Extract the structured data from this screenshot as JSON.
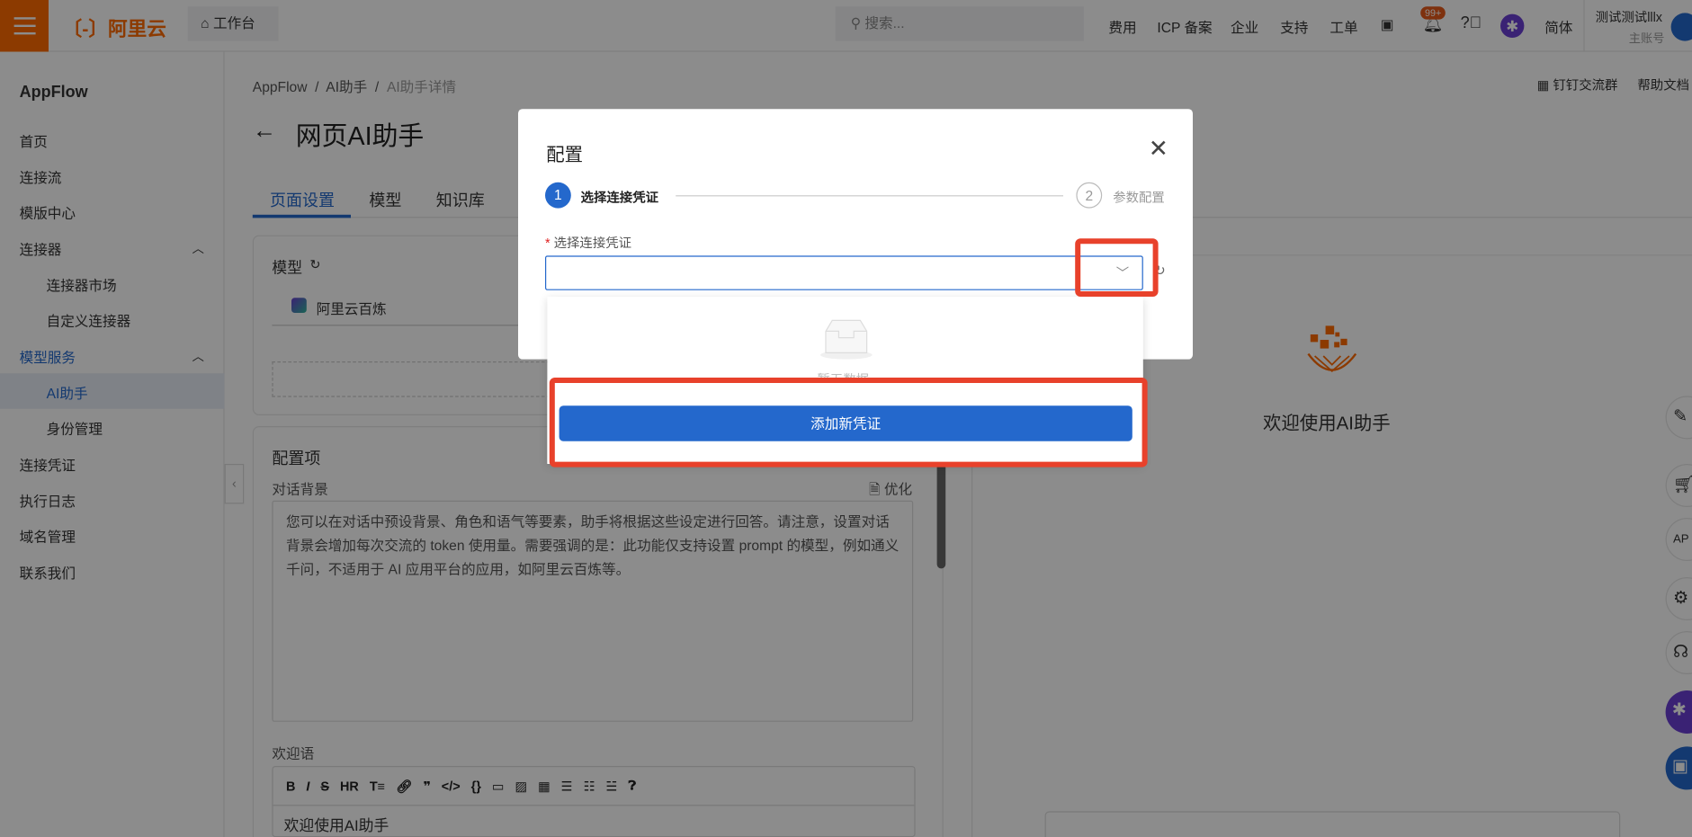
{
  "header": {
    "logo": "阿里云",
    "workbench": "工作台",
    "search_placeholder": "搜索...",
    "nav": [
      "费用",
      "ICP 备案",
      "企业",
      "支持",
      "工单"
    ],
    "notifications": "99+",
    "language": "简体",
    "account_name": "测试测试lllx",
    "account_type": "主账号"
  },
  "sidebar": {
    "app": "AppFlow",
    "items": [
      {
        "label": "首页"
      },
      {
        "label": "连接流"
      },
      {
        "label": "模版中心"
      },
      {
        "label": "连接器"
      },
      {
        "label": "连接器市场"
      },
      {
        "label": "自定义连接器"
      },
      {
        "label": "模型服务"
      },
      {
        "label": "AI助手"
      },
      {
        "label": "身份管理"
      },
      {
        "label": "连接凭证"
      },
      {
        "label": "执行日志"
      },
      {
        "label": "域名管理"
      },
      {
        "label": "联系我们"
      }
    ]
  },
  "breadcrumb": [
    "AppFlow",
    "AI助手",
    "AI助手详情"
  ],
  "top_links": {
    "dingtalk": "钉钉交流群",
    "help": "帮助文档"
  },
  "page": {
    "title": "网页AI助手",
    "tabs": [
      "页面设置",
      "模型",
      "知识库"
    ],
    "model_label": "模型",
    "model_name": "阿里云百炼",
    "config_label": "配置项",
    "bg_label": "对话背景",
    "optimize": "优化",
    "bg_text": "您可以在对话中预设背景、角色和语气等要素，助手将根据这些设定进行回答。请注意，设置对话背景会增加每次交流的 token 使用量。需要强调的是：此功能仅支持设置 prompt 的模型，例如通义千问，不适用于 AI 应用平台的应用，如阿里云百炼等。",
    "welcome_label": "欢迎语",
    "welcome_text": "欢迎使用AI助手"
  },
  "preview": {
    "welcome": "欢迎使用AI助手"
  },
  "modal": {
    "title": "配置",
    "steps": [
      {
        "num": "1",
        "label": "选择连接凭证"
      },
      {
        "num": "2",
        "label": "参数配置"
      }
    ],
    "field_label": "选择连接凭证",
    "required_mark": "*",
    "empty": "暂无数据",
    "add_button": "添加新凭证"
  }
}
